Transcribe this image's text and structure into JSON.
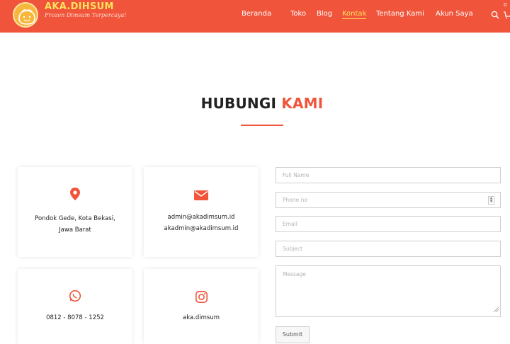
{
  "brand": {
    "name": "AKA.DIHSUM",
    "tagline": "Frozen Dimsum Terpercaya!"
  },
  "nav": {
    "items": [
      "Beranda",
      "Toko",
      "Blog",
      "Kontak",
      "Tentang Kami",
      "Akun Saya"
    ],
    "active": "Kontak",
    "cart_count": "0"
  },
  "page": {
    "title_main": "HUBUNGI ",
    "title_accent": "KAMI"
  },
  "contact": {
    "address_line1": "Pondok Gede, Kota Bekasi,",
    "address_line2": "Jawa Barat",
    "email1": "admin@akadimsum.id",
    "email2": "akadmin@akadimsum.id",
    "phone": "0812 - 8078 - 1252",
    "instagram": "aka.dimsum"
  },
  "form": {
    "full_name_placeholder": "Full Name",
    "phone_placeholder": "Phone no",
    "email_placeholder": "Email",
    "subject_placeholder": "Subject",
    "message_placeholder": "Message",
    "submit_label": "Submit"
  },
  "colors": {
    "accent": "#f0553c",
    "brand_yellow": "#ffe15a",
    "whatsapp_green": "#7ad37a"
  }
}
